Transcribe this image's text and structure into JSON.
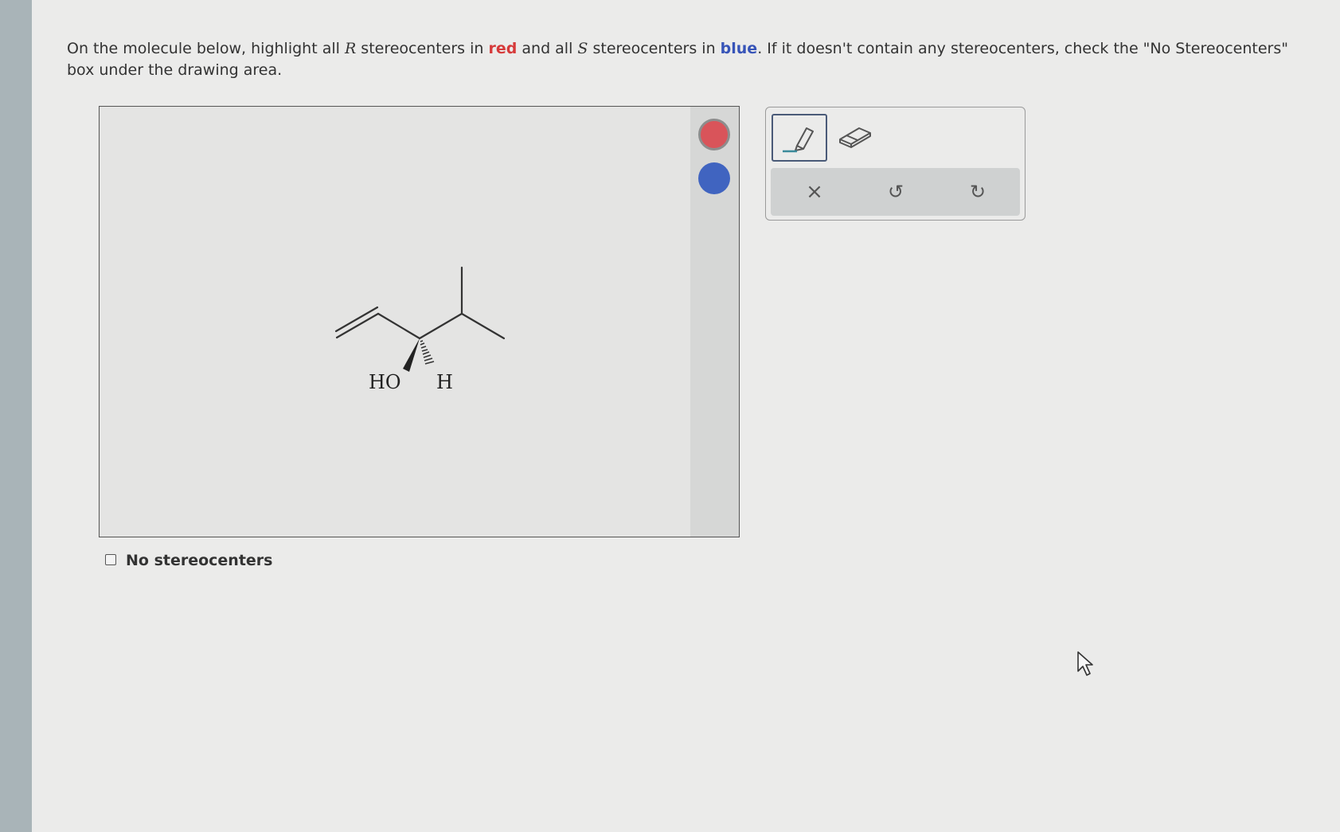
{
  "question": {
    "t1": "On the molecule below, highlight all ",
    "var_r": "R",
    "t2": " stereocenters in ",
    "red_word": "red",
    "t3": " and all ",
    "var_s": "S",
    "t4": " stereocenters in ",
    "blue_word": "blue",
    "t5": ". If it doesn't contain any stereocenters, check the \"No Stereocenters\" box under the drawing area."
  },
  "molecule": {
    "label_oh": "HO",
    "label_h": "H"
  },
  "palette": {
    "red_color": "#d9545a",
    "blue_color": "#4064c0"
  },
  "toolbar": {
    "pen_icon": "highlighter-icon",
    "eraser_icon": "eraser-icon",
    "clear_glyph": "×",
    "undo_glyph": "↺",
    "redo_glyph": "↻"
  },
  "no_stereocenters": {
    "label": "No stereocenters",
    "checked": false
  }
}
